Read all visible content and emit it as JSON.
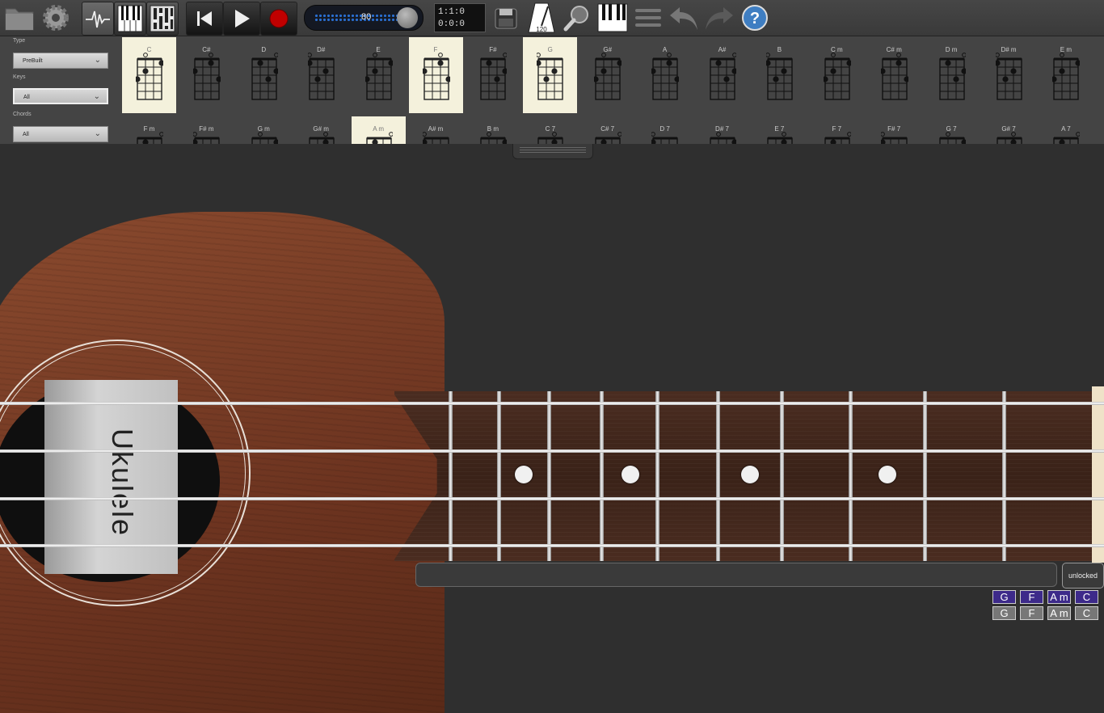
{
  "toolbar": {
    "tempo_value": "80",
    "position_bars": "1:1:0",
    "position_time": "0:0:0",
    "metronome_value": "120",
    "icons": [
      "folder-icon",
      "gear-icon",
      "waveform-icon",
      "piano-keys-icon",
      "mixer-icon",
      "rewind-icon",
      "play-icon",
      "record-icon",
      "save-disk-icon",
      "metronome-icon",
      "search-icon",
      "keyboard-icon",
      "menu-icon",
      "undo-icon",
      "redo-icon",
      "help-icon"
    ]
  },
  "sidebar": {
    "type_label": "Type",
    "type_value": "PreBuilt",
    "keys_label": "Keys",
    "keys_value": "All",
    "chords_label": "Chords",
    "chords_value": "All"
  },
  "chords_row1": [
    {
      "name": "C",
      "hl": true
    },
    {
      "name": "C#"
    },
    {
      "name": "D"
    },
    {
      "name": "D#"
    },
    {
      "name": "E"
    },
    {
      "name": "F",
      "hl": true
    },
    {
      "name": "F#"
    },
    {
      "name": "G",
      "hl": true
    },
    {
      "name": "G#"
    },
    {
      "name": "A"
    },
    {
      "name": "A#"
    },
    {
      "name": "B"
    },
    {
      "name": "C m"
    },
    {
      "name": "C# m"
    },
    {
      "name": "D m"
    },
    {
      "name": "D# m"
    },
    {
      "name": "E m"
    }
  ],
  "chords_row2": [
    {
      "name": "F m"
    },
    {
      "name": "F# m"
    },
    {
      "name": "G m"
    },
    {
      "name": "G# m"
    },
    {
      "name": "A m",
      "hl": true
    },
    {
      "name": "A# m"
    },
    {
      "name": "B m"
    },
    {
      "name": "C 7"
    },
    {
      "name": "C# 7"
    },
    {
      "name": "D 7"
    },
    {
      "name": "D# 7"
    },
    {
      "name": "E 7"
    },
    {
      "name": "F 7"
    },
    {
      "name": "F# 7"
    },
    {
      "name": "G 7"
    },
    {
      "name": "G# 7"
    },
    {
      "name": "A 7"
    }
  ],
  "instrument": {
    "label": "Ukulele"
  },
  "bottom": {
    "lock_label": "unlocked",
    "progression_top": [
      "G",
      "F",
      "A m",
      "C"
    ],
    "progression_bottom": [
      "G",
      "F",
      "A m",
      "C"
    ]
  },
  "colors": {
    "highlight_chord": "#f4f1dc",
    "progression_active": "#3d2a8a",
    "record": "#c00000",
    "tempo_dots": "#2a6fd0"
  }
}
